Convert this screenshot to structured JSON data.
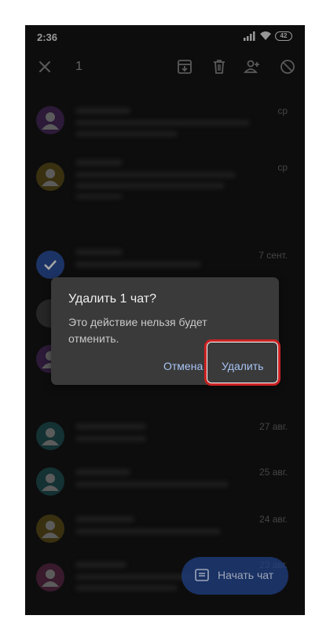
{
  "status_bar": {
    "time": "2:36",
    "battery": "42"
  },
  "toolbar": {
    "selected_count": "1",
    "icons": [
      "close-icon",
      "archive-icon",
      "delete-icon",
      "add-contact-icon",
      "block-icon"
    ]
  },
  "chats": [
    {
      "date": "ср",
      "avatar_color": "#7b4a9c"
    },
    {
      "date": "ср",
      "avatar_color": "#a0862f"
    },
    {
      "date": "7 сент.",
      "avatar_color": "#2b4f9c",
      "selected": true
    },
    {
      "date": "",
      "avatar_color": "#6b6b6b"
    },
    {
      "date": "",
      "avatar_color": "#7b4a9c"
    },
    {
      "date": "27 авг.",
      "avatar_color": "#3b8a8f"
    },
    {
      "date": "25 авг.",
      "avatar_color": "#3b8a8f"
    },
    {
      "date": "24 авг.",
      "avatar_color": "#a0862f"
    },
    {
      "date": "23 авг.",
      "avatar_color": "#9c4a7b"
    }
  ],
  "dialog": {
    "title": "Удалить 1 чат?",
    "message": "Это действие нельзя будет отменить.",
    "cancel_label": "Отмена",
    "confirm_label": "Удалить"
  },
  "fab": {
    "label": "Начать чат"
  },
  "colors": {
    "accent": "#a8c4f5",
    "highlight": "#cc2222",
    "background": "#141414"
  }
}
